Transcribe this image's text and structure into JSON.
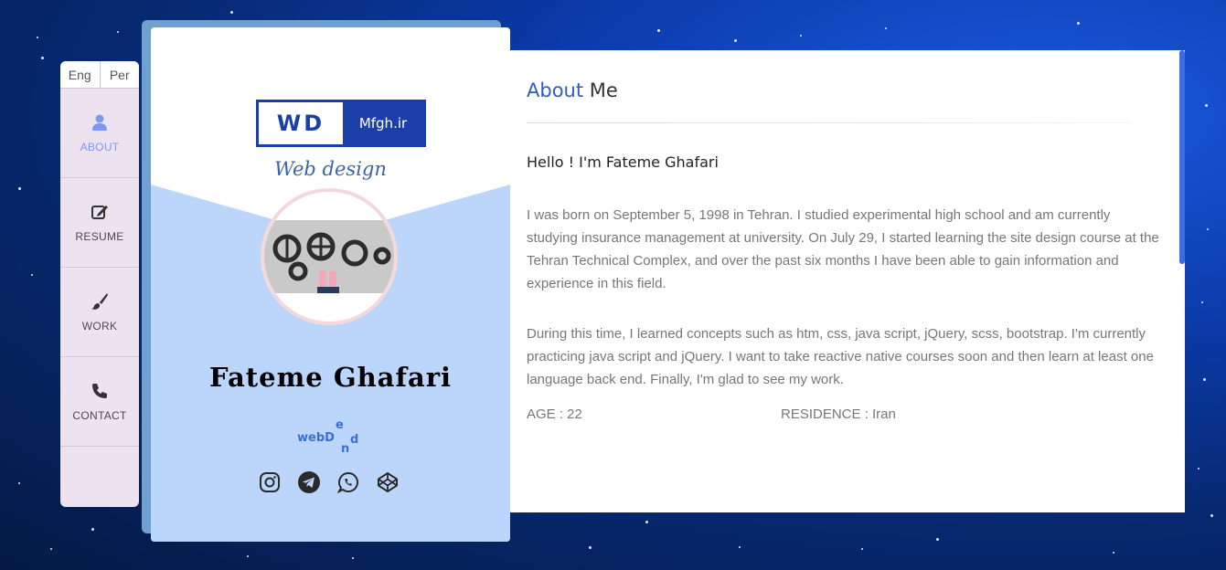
{
  "lang": {
    "eng": "Eng",
    "per": "Per"
  },
  "nav": {
    "items": [
      {
        "label": "ABOUT",
        "icon": "user-icon",
        "active": true
      },
      {
        "label": "RESUME",
        "icon": "edit-icon"
      },
      {
        "label": "WORK",
        "icon": "brush-icon"
      },
      {
        "label": "CONTACT",
        "icon": "phone-icon"
      }
    ]
  },
  "profile": {
    "logo_mark": "WD",
    "logo_site": "Mfgh.ir",
    "tagline": "Web design",
    "name": "Fateme Ghafari",
    "brand": {
      "w1": "webD",
      "e": "e",
      "n": "n",
      "d": "d"
    },
    "socials": [
      "instagram-icon",
      "telegram-icon",
      "whatsapp-icon",
      "codepen-icon"
    ]
  },
  "about": {
    "title_accent": "About",
    "title_rest": " Me",
    "hello": "Hello ! I'm Fateme Ghafari",
    "p1": "I was born on September 5, 1998 in Tehran. I studied experimental high school and am currently studying insurance management at university. On July 29, I started learning the site design course at the Tehran Technical Complex, and over the past six months I have been able to gain information and experience in this field.",
    "p2": "During this time, I learned concepts such as htm, css, java script, jQuery, scss, bootstrap. I'm currently practicing java script and jQuery. I want to take reactive native courses soon and then learn at least one language back end. Finally, I'm glad to see my work.",
    "age": "AGE : 22",
    "residence": "RESIDENCE : Iran"
  },
  "colors": {
    "accent": "#2f5bc4",
    "nav_active": "#7d97f5",
    "card_blue": "#bcd6fb"
  }
}
